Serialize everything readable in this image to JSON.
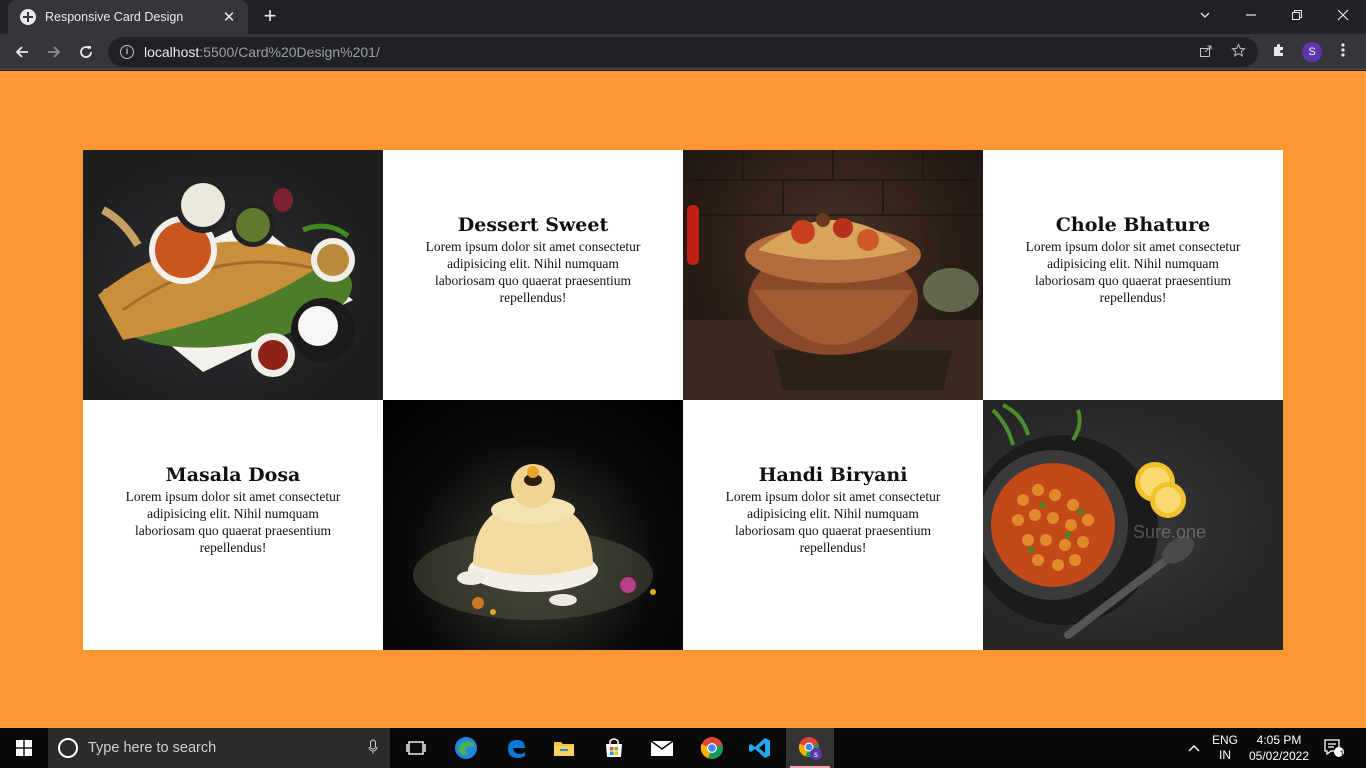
{
  "browser": {
    "tab_title": "Responsive Card Design",
    "tab_close": "✕",
    "new_tab": "+",
    "url_host": "localhost",
    "url_rest": ":5500/Card%20Design%201/",
    "profile_initial": "S"
  },
  "cards": {
    "dessert_sweet": {
      "title": "Dessert Sweet",
      "text": "Lorem ipsum dolor sit amet consectetur adipisicing elit. Nihil numquam laboriosam quo quaerat praesentium repellendus!"
    },
    "chole_bhature": {
      "title": "Chole Bhature",
      "text": "Lorem ipsum dolor sit amet consectetur adipisicing elit. Nihil numquam laboriosam quo quaerat praesentium repellendus!"
    },
    "masala_dosa": {
      "title": "Masala Dosa",
      "text": "Lorem ipsum dolor sit amet consectetur adipisicing elit. Nihil numquam laboriosam quo quaerat praesentium repellendus!"
    },
    "handi_biryani": {
      "title": "Handi Biryani",
      "text": "Lorem ipsum dolor sit amet consectetur adipisicing elit. Nihil numquam laboriosam quo quaerat praesentium repellendus!"
    }
  },
  "images": {
    "watermark": "Sure.one"
  },
  "taskbar": {
    "search_placeholder": "Type here to search",
    "lang_line1": "ENG",
    "lang_line2": "IN",
    "time": "4:05 PM",
    "date": "05/02/2022",
    "notification_count": "1"
  },
  "colors": {
    "page_background": "#ff9634",
    "card_background": "#ffffff",
    "chrome_frame": "#202124",
    "chrome_toolbar": "#35363a"
  }
}
